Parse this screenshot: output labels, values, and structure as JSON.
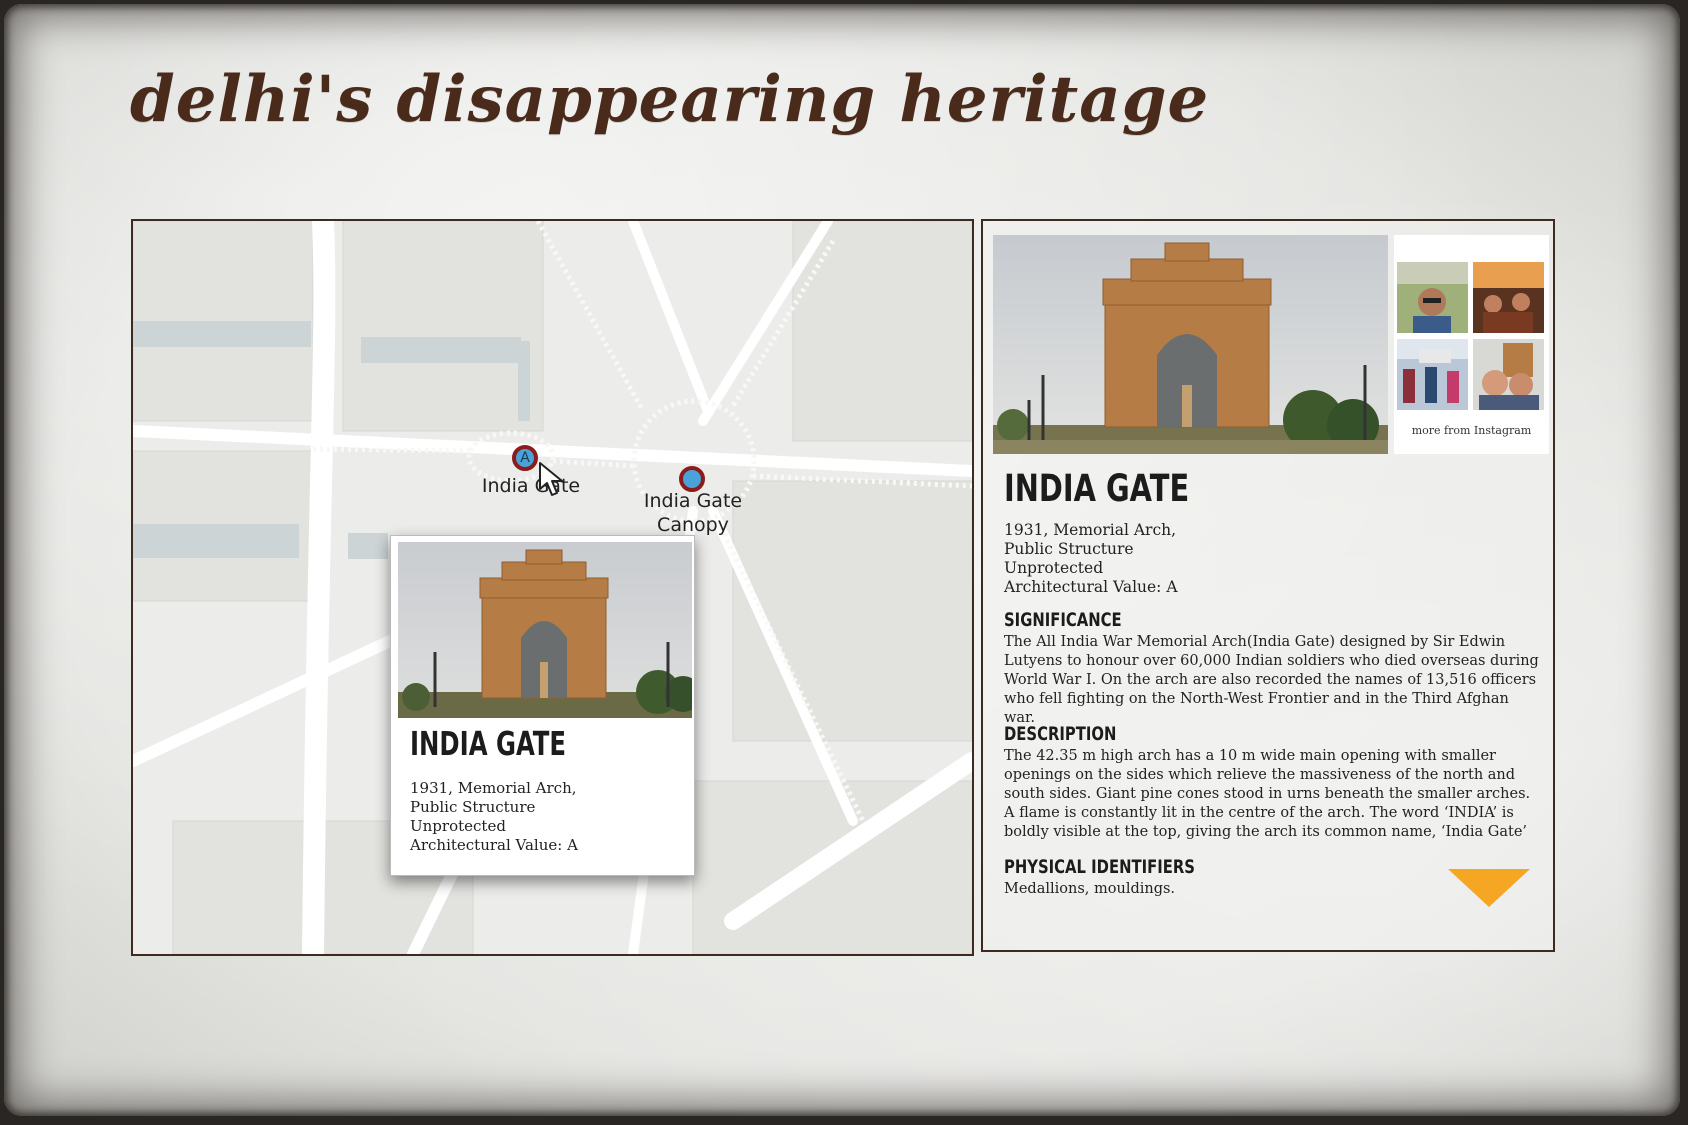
{
  "page": {
    "title": "delhi's disappearing heritage"
  },
  "map": {
    "markers": [
      {
        "letter": "A",
        "label": "India Gate"
      },
      {
        "letter": "",
        "label_line1": "India Gate",
        "label_line2": "Canopy"
      }
    ],
    "popup": {
      "name": "INDIA GATE",
      "meta": [
        "1931, Memorial Arch,",
        "Public Structure",
        "Unprotected",
        "Architectural Value: A"
      ]
    }
  },
  "detail": {
    "name": "INDIA GATE",
    "meta": [
      "1931, Memorial Arch,",
      "Public Structure",
      "Unprotected",
      "Architectural Value: A"
    ],
    "instagram_label": "more from Instagram",
    "significance": {
      "heading": "SIGNIFICANCE",
      "body": "The All India War Memorial Arch(India Gate) designed by Sir Edwin Lutyens to honour over 60,000 Indian soldiers who died overseas during World War I. On the arch are also recorded the names of 13,516 officers who fell fighting on the North-West Frontier and in the Third Afghan war."
    },
    "description": {
      "heading": "DESCRIPTION",
      "body": "The 42.35 m high arch has a 10 m wide main opening with smaller openings on the sides which relieve the massiveness of the north and south sides. Giant pine cones stood in urns beneath the smaller arches. A flame is constantly lit in the centre of the arch. The word ‘INDIA’ is boldly visible at the top, giving the arch its common name, ‘India Gate’"
    },
    "identifiers": {
      "heading": "PHYSICAL IDENTIFIERS",
      "body": "Medallions, mouldings."
    }
  },
  "colors": {
    "title": "#4a2a1a",
    "marker_fill": "#4aa3d8",
    "marker_ring": "#8c1c1c",
    "arrow": "#f5a623",
    "frame": "#3e2a1e"
  },
  "icons": [
    "cursor-icon",
    "down-arrow-icon"
  ]
}
